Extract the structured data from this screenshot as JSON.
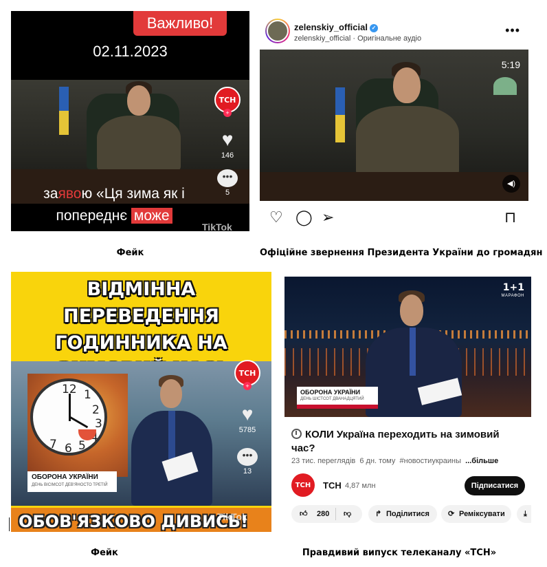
{
  "panel1": {
    "badge": "Важливо!",
    "date": "02.11.2023",
    "subtitle_line1_a": "за",
    "subtitle_line1_hl": "яво",
    "subtitle_line1_b": "ю «Ця зима як і",
    "subtitle_line2_a": "попереднє",
    "subtitle_line2_box": "може",
    "channel_badge": "ТСН",
    "likes": "146",
    "comments": "5",
    "watermark": "TikTok",
    "caption": "Фейк"
  },
  "panel2": {
    "username": "zelenskiy_official",
    "audio": "zelenskiy_official · Оригінальне аудіо",
    "duration": "5:19",
    "caption": "Офіційне звернення Президента України до громадян"
  },
  "panel3": {
    "headline_line1": "ВІДМІННА ПЕРЕВЕДЕННЯ",
    "headline_line2": "ГОДИННИКА НА",
    "headline_line3": "ЗИМОВИЙ ЧАС!",
    "banner_title": "ОБОРОНА УКРАЇНИ",
    "banner_sub": "ДЕНЬ ВІСІМСОТ ДЕВ'ЯНОСТО ТРЕТІЙ",
    "channel_badge": "ТСН",
    "likes": "5785",
    "comments": "13",
    "bottom_text": "ОБОВ'ЯЗКОВО ДИВИСЬ!",
    "watermark": "TikTok",
    "clock_numbers": [
      "12",
      "1",
      "2",
      "3",
      "4",
      "5",
      "6",
      "7"
    ],
    "caption": "Фейк"
  },
  "panel4": {
    "logo": "1+1",
    "logo_sub": "МАРАФОН",
    "banner_title": "ОБОРОНА УКРАЇНИ",
    "banner_sub": "ДЕНЬ ШІСТСОТ ДВАНАДЦЯТИЙ",
    "title": "КОЛИ Україна переходить на зимовий час?",
    "views": "23 тис. переглядів",
    "age": "6 дн. тому",
    "hashtag": "#новостиукраины",
    "more": "...більше",
    "channel_avatar": "ТСН",
    "channel": "ТСН",
    "subscribers": "4,87 млн",
    "subscribe": "Підписатися",
    "likes": "280",
    "share": "Поділитися",
    "remix": "Реміксувати",
    "caption": "Правдивий випуск телеканалу «ТСН»"
  },
  "colors": {
    "tsn_red": "#e11b22",
    "fake_red": "#e23a3a",
    "yellow": "#f9d40c",
    "orange": "#e8821b"
  }
}
